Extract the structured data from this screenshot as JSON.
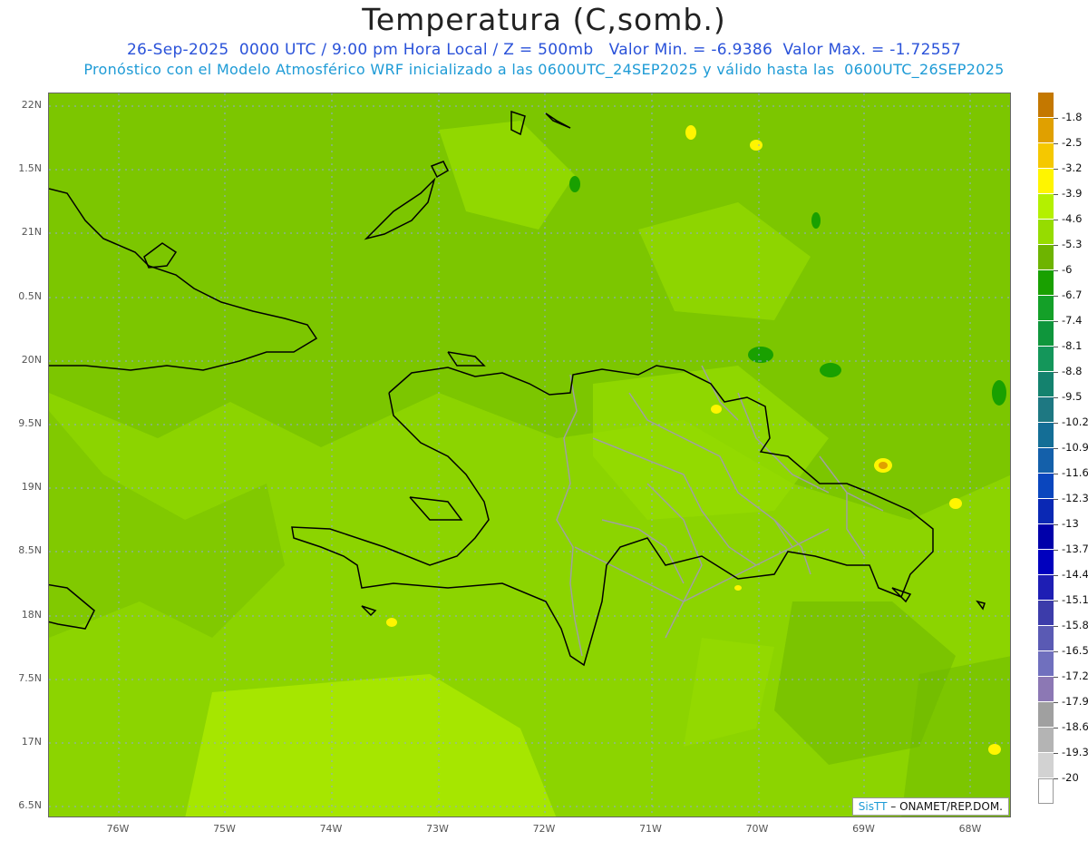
{
  "title": "Temperatura (C,somb.)",
  "subtitle_line1": "26-Sep-2025  0000 UTC / 9:00 pm Hora Local / Z = 500mb   Valor Min. = -6.9386  Valor Max. = -1.72557",
  "subtitle_line2": "Pronóstico con el Modelo Atmosférico WRF inicializado a las 0600UTC_24SEP2025 y válido hasta las  0600UTC_26SEP2025",
  "lat_labels": [
    "22N",
    "1.5N",
    "21N",
    "0.5N",
    "20N",
    "9.5N",
    "19N",
    "8.5N",
    "18N",
    "7.5N",
    "17N",
    "6.5N"
  ],
  "lon_labels": [
    "76W",
    "75W",
    "74W",
    "73W",
    "72W",
    "71W",
    "70W",
    "69W",
    "68W"
  ],
  "credit": {
    "brand": "SisTT",
    "text": "– ONAMET/REP.DOM."
  },
  "colorbar": {
    "labels": [
      "-1.8",
      "-2.5",
      "-3.2",
      "-3.9",
      "-4.6",
      "-5.3",
      "-6",
      "-6.7",
      "-7.4",
      "-8.1",
      "-8.8",
      "-9.5",
      "-10.2",
      "-10.9",
      "-11.6",
      "-12.3",
      "-13",
      "-13.7",
      "-14.4",
      "-15.1",
      "-15.8",
      "-16.5",
      "-17.2",
      "-17.9",
      "-18.6",
      "-19.3",
      "-20"
    ],
    "colors": [
      "#c47800",
      "#e0a000",
      "#f5c800",
      "#fff500",
      "#b4f000",
      "#96dc00",
      "#6eb400",
      "#19a000",
      "#14a028",
      "#0f963c",
      "#14965a",
      "#14826e",
      "#1e7882",
      "#146e96",
      "#1460aa",
      "#0a46be",
      "#0a28b4",
      "#0000aa",
      "#0000be",
      "#1e1eb4",
      "#3c3caa",
      "#5a5ab4",
      "#7070be",
      "#8c78b4",
      "#a0a0a0",
      "#b4b4b4",
      "#d2d2d2",
      "#ffffff"
    ]
  }
}
